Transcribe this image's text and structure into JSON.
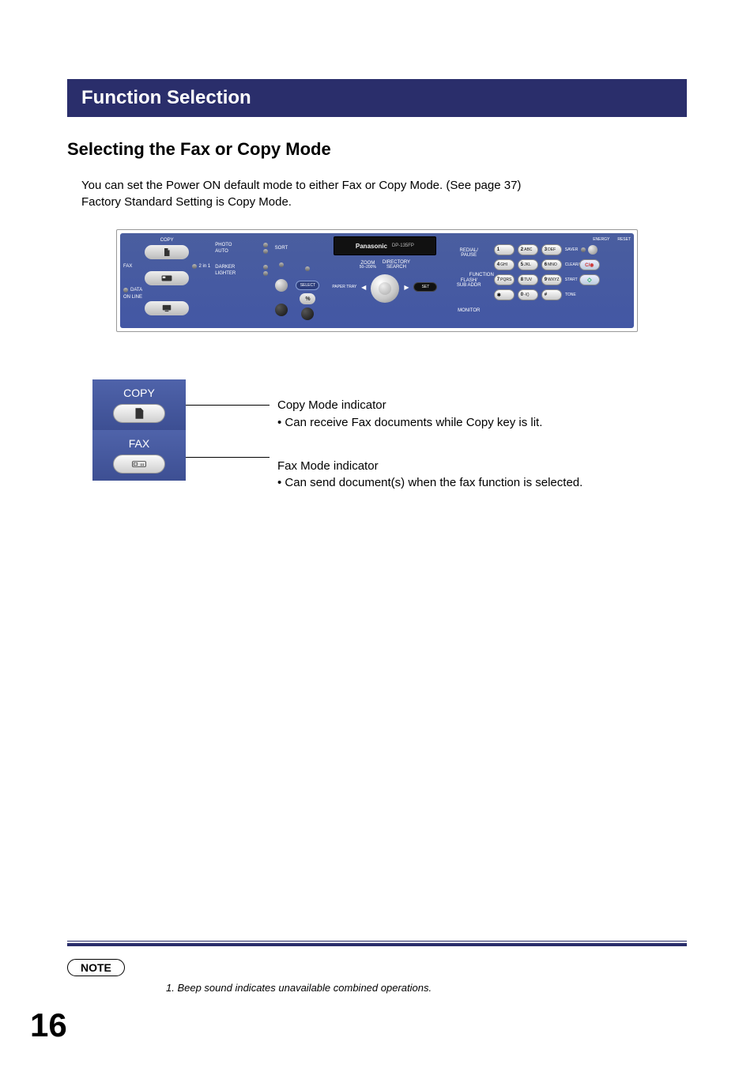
{
  "title_bar": "Function Selection",
  "subheading": "Selecting the Fax or Copy Mode",
  "intro_line1": "You can set the Power ON default mode to either Fax or Copy Mode. (See page 37)",
  "intro_line2": "Factory Standard Setting is Copy Mode.",
  "panel": {
    "brand": "Panasonic",
    "model": "DP-135FP",
    "labels": {
      "copy": "COPY",
      "fax": "FAX",
      "online": "ON LINE",
      "data": "DATA",
      "twoin1": "2 in 1",
      "photo": "PHOTO",
      "auto": "AUTO",
      "darker": "DARKER",
      "lighter": "LIGHTER",
      "sort": "SORT",
      "select": "SELECT",
      "percent": "%",
      "zoom": "ZOOM",
      "zoom_sub": "50–200%",
      "directory": "DIRECTORY",
      "search": "SEARCH",
      "paper_tray": "PAPER TRAY",
      "set": "SET",
      "redial": "REDIAL/",
      "pause": "PAUSE",
      "flash": "FLASH/",
      "subaddr": "SUB ADDR",
      "monitor": "MONITOR",
      "function": "FUNCTION",
      "energy": "ENERGY",
      "saver": "SAVER",
      "reset": "RESET",
      "clearstop": "CLEAR/STOP",
      "start": "START",
      "tone": "TONE",
      "clear_btn": "C/◉"
    },
    "keys": [
      [
        "1",
        ""
      ],
      [
        "2",
        "ABC"
      ],
      [
        "3",
        "DEF"
      ],
      [
        "4",
        "GHI"
      ],
      [
        "5",
        "JKL"
      ],
      [
        "6",
        "MNO"
      ],
      [
        "7",
        "PQRS"
      ],
      [
        "8",
        "TUV"
      ],
      [
        "9",
        "WXYZ"
      ],
      [
        "✱",
        ""
      ],
      [
        "0",
        "-/()"
      ],
      [
        "#",
        ""
      ]
    ]
  },
  "indicators": {
    "copy_label": "COPY",
    "fax_label": "FAX",
    "copy_title": "Copy Mode indicator",
    "copy_bullet": "• Can receive Fax documents while Copy key is lit.",
    "fax_title": "Fax Mode indicator",
    "fax_bullet": "• Can send document(s) when the fax function is selected."
  },
  "note_label": "NOTE",
  "note_text": "1. Beep sound indicates unavailable combined operations.",
  "page_number": "16"
}
